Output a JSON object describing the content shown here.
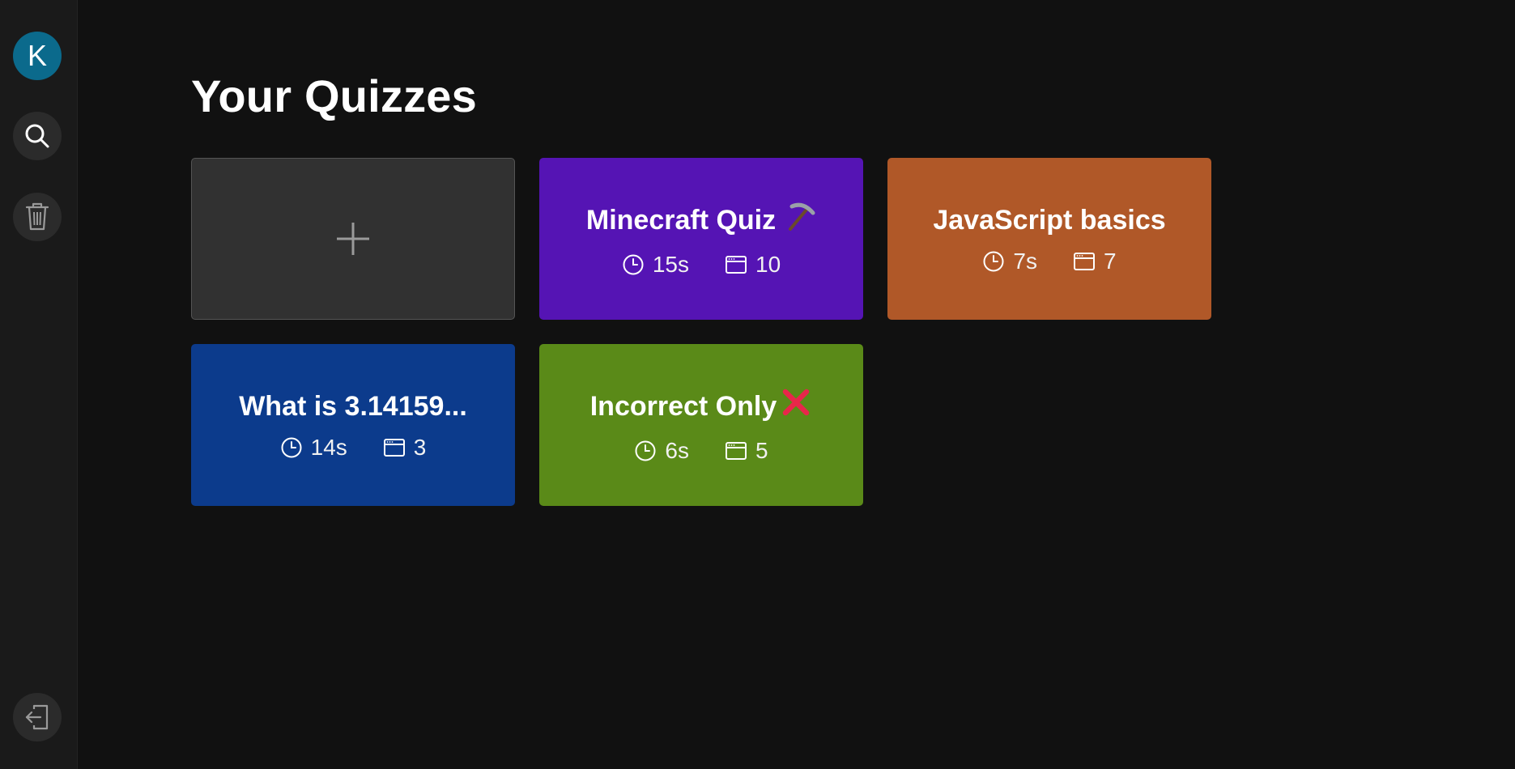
{
  "user": {
    "initial": "K",
    "avatar_color": "#0b6a8c"
  },
  "sidebar": {
    "search_icon": "search-icon",
    "trash_icon": "trash-icon",
    "logout_icon": "logout-icon"
  },
  "page": {
    "title": "Your Quizzes"
  },
  "add_card": {
    "icon": "plus-icon"
  },
  "quizzes": [
    {
      "title": "Minecraft Quiz",
      "emoji": "pickaxe-icon",
      "time": "15s",
      "questions": "10",
      "color": "#5514b4"
    },
    {
      "title": "JavaScript basics",
      "emoji": "",
      "time": "7s",
      "questions": "7",
      "color": "#b05828"
    },
    {
      "title": "What is 3.14159...",
      "emoji": "",
      "time": "14s",
      "questions": "3",
      "color": "#0c3b8c"
    },
    {
      "title": "Incorrect Only",
      "emoji": "cross-mark-icon",
      "time": "6s",
      "questions": "5",
      "color": "#5a8a18"
    }
  ]
}
